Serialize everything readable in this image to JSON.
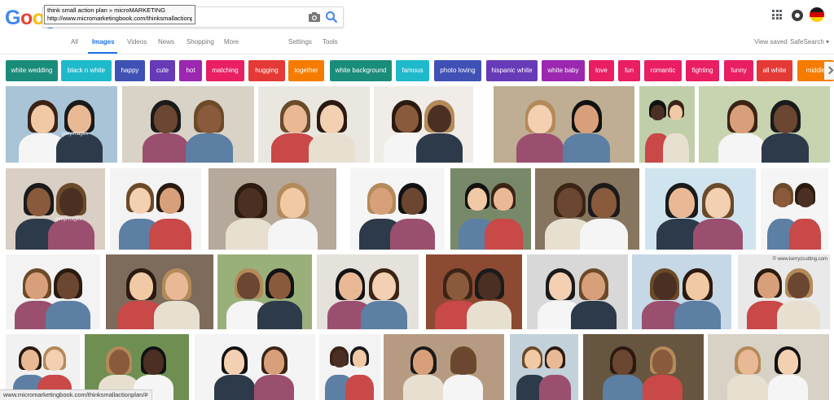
{
  "logo": {
    "letters": [
      "G",
      "o",
      "o",
      "g"
    ],
    "colors": [
      "#4285F4",
      "#EA4335",
      "#FBBC05",
      "#4285F4"
    ]
  },
  "search": {
    "tooltip_line1": "think small action plan » microMARKETING",
    "tooltip_line2": "http://www.micromarketingbook.com/thinksmallactionplan/#",
    "icons": [
      "camera-icon",
      "search-icon"
    ]
  },
  "tabs": [
    "All",
    "Images",
    "Videos",
    "News",
    "Shopping",
    "More",
    "Settings",
    "Tools"
  ],
  "right_links": {
    "view_saved": "View saved",
    "safesearch": "SafeSearch ▾"
  },
  "chips": [
    {
      "label": "white wedding",
      "color": "#1a8c7a"
    },
    {
      "label": "black n white",
      "color": "#1fb9cc"
    },
    {
      "label": "happy",
      "color": "#3f51b5"
    },
    {
      "label": "cute",
      "color": "#673ab7"
    },
    {
      "label": "hot",
      "color": "#9c27b0"
    },
    {
      "label": "matching",
      "color": "#e91e63"
    },
    {
      "label": "hugging",
      "color": "#e53935"
    },
    {
      "label": "together",
      "color": "#f57c00"
    },
    {
      "label": "white background",
      "color": "#1a8c7a"
    },
    {
      "label": "famous",
      "color": "#1fb9cc"
    },
    {
      "label": "photo loving",
      "color": "#3f51b5"
    },
    {
      "label": "hispanic white",
      "color": "#673ab7"
    },
    {
      "label": "white baby",
      "color": "#9c27b0"
    },
    {
      "label": "love",
      "color": "#e91e63"
    },
    {
      "label": "fun",
      "color": "#e91e63"
    },
    {
      "label": "romantic",
      "color": "#e91e63"
    },
    {
      "label": "fighting",
      "color": "#e91e63"
    },
    {
      "label": "funny",
      "color": "#e91e63"
    },
    {
      "label": "all white",
      "color": "#e53935"
    },
    {
      "label": "middle",
      "color": "#f57c00"
    }
  ],
  "image_watermarks": {
    "gettyimages": "gettyimages",
    "dreamstime": "dreamstime.com",
    "kerryzcutting": "© www.kerryzcutting.com"
  },
  "status_url": "www.micromarketingbook.com/thinksmallactionplan/#"
}
